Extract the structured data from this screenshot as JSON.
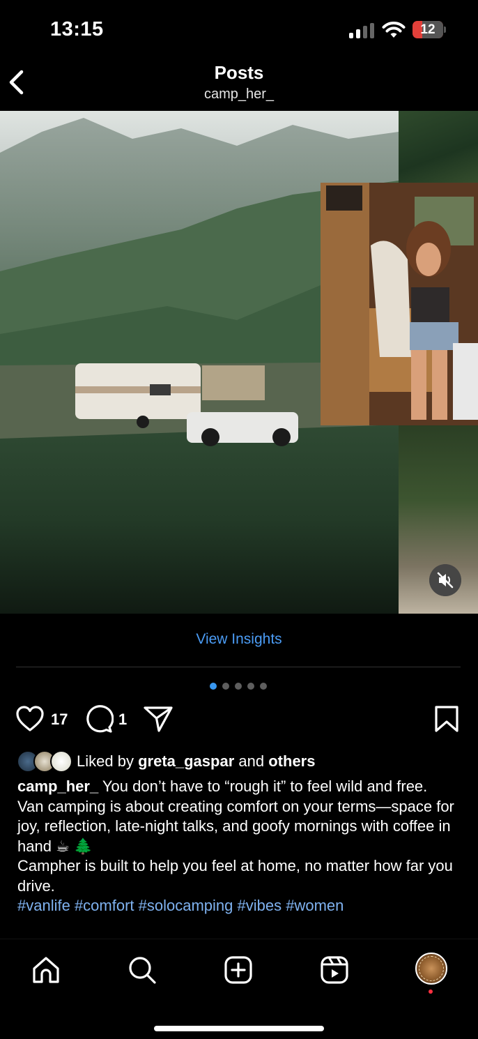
{
  "status_bar": {
    "time": "13:15",
    "battery": "12"
  },
  "header": {
    "title": "Posts",
    "username": "camp_her_"
  },
  "post": {
    "insights_label": "View Insights",
    "carousel": {
      "total": 5,
      "active_index": 0
    },
    "like_count": "17",
    "comment_count": "1",
    "liked_by_prefix": "Liked by",
    "liked_by_user": "greta_gaspar",
    "liked_by_and": "and",
    "liked_by_others": "others",
    "caption": {
      "author": "camp_her_",
      "line1": "You don’t have to “rough it” to feel wild and free.",
      "line2": "Van camping is about creating comfort on your terms—space for joy, reflection, late-night talks, and goofy mornings with coffee in hand ☕ 🌲",
      "line3": "Campher is built to help you feel at home, no matter how far you drive.",
      "hashtags": "#vanlife #comfort #solocamping #vibes #women"
    }
  },
  "tab_bar": {
    "items": [
      "home-icon",
      "search-icon",
      "create-icon",
      "reels-icon",
      "profile-avatar"
    ]
  },
  "colors": {
    "link": "#4b9cf5",
    "hashtag": "#7fb2f0",
    "active_dot": "#3897f0",
    "notification": "#ff3040"
  }
}
